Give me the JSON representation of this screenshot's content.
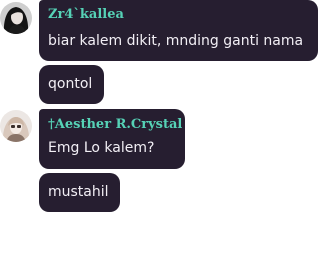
{
  "messages": [
    {
      "sender": "Zr4`kallea",
      "avatar_icon": "dark-haired-woman-avatar",
      "lines": [
        "biar kalem dikit, mnding ganti nama",
        "qontol"
      ]
    },
    {
      "sender": "†Aesther R.Crystal",
      "avatar_icon": "light-haired-girl-avatar",
      "lines": [
        "Emg Lo kalem?",
        "mustahil"
      ]
    }
  ],
  "colors": {
    "bubble": "#261e30",
    "sender_name": "#56d2b6",
    "message_text": "#f2eff5",
    "background": "#ffffff"
  }
}
